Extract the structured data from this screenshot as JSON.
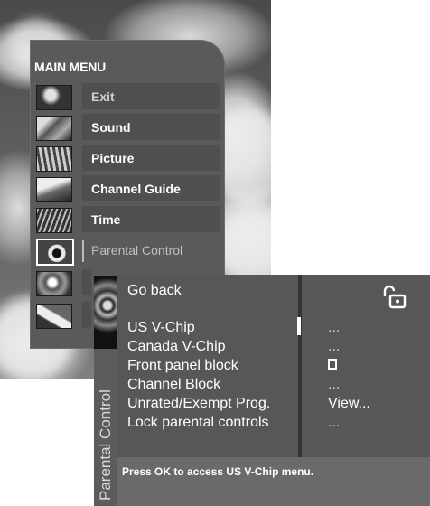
{
  "main_menu": {
    "title": "MAIN MENU",
    "items": [
      {
        "label": "Exit",
        "icon": "exit-icon"
      },
      {
        "label": "Sound",
        "icon": "sound-icon"
      },
      {
        "label": "Picture",
        "icon": "picture-icon"
      },
      {
        "label": "Channel Guide",
        "icon": "channel-guide-icon"
      },
      {
        "label": "Time",
        "icon": "time-icon"
      },
      {
        "label": "Parental Control",
        "icon": "parental-control-icon",
        "selected": true
      },
      {
        "label": "",
        "icon": "setup-icon"
      },
      {
        "label": "",
        "icon": "remote-icon"
      }
    ]
  },
  "parental_control": {
    "title": "Parental Control",
    "go_back": "Go back",
    "lock_icon": "unlocked-padlock-icon",
    "items": [
      {
        "label": "US V-Chip",
        "value": "..."
      },
      {
        "label": "Canada V-Chip",
        "value": "..."
      },
      {
        "label": "Front panel block",
        "value": ""
      },
      {
        "label": "Channel Block",
        "value": "..."
      },
      {
        "label": "Unrated/Exempt Prog.",
        "value": "View..."
      },
      {
        "label": "Lock parental controls",
        "value": "..."
      }
    ],
    "status": "Press OK to access US V-Chip menu."
  }
}
